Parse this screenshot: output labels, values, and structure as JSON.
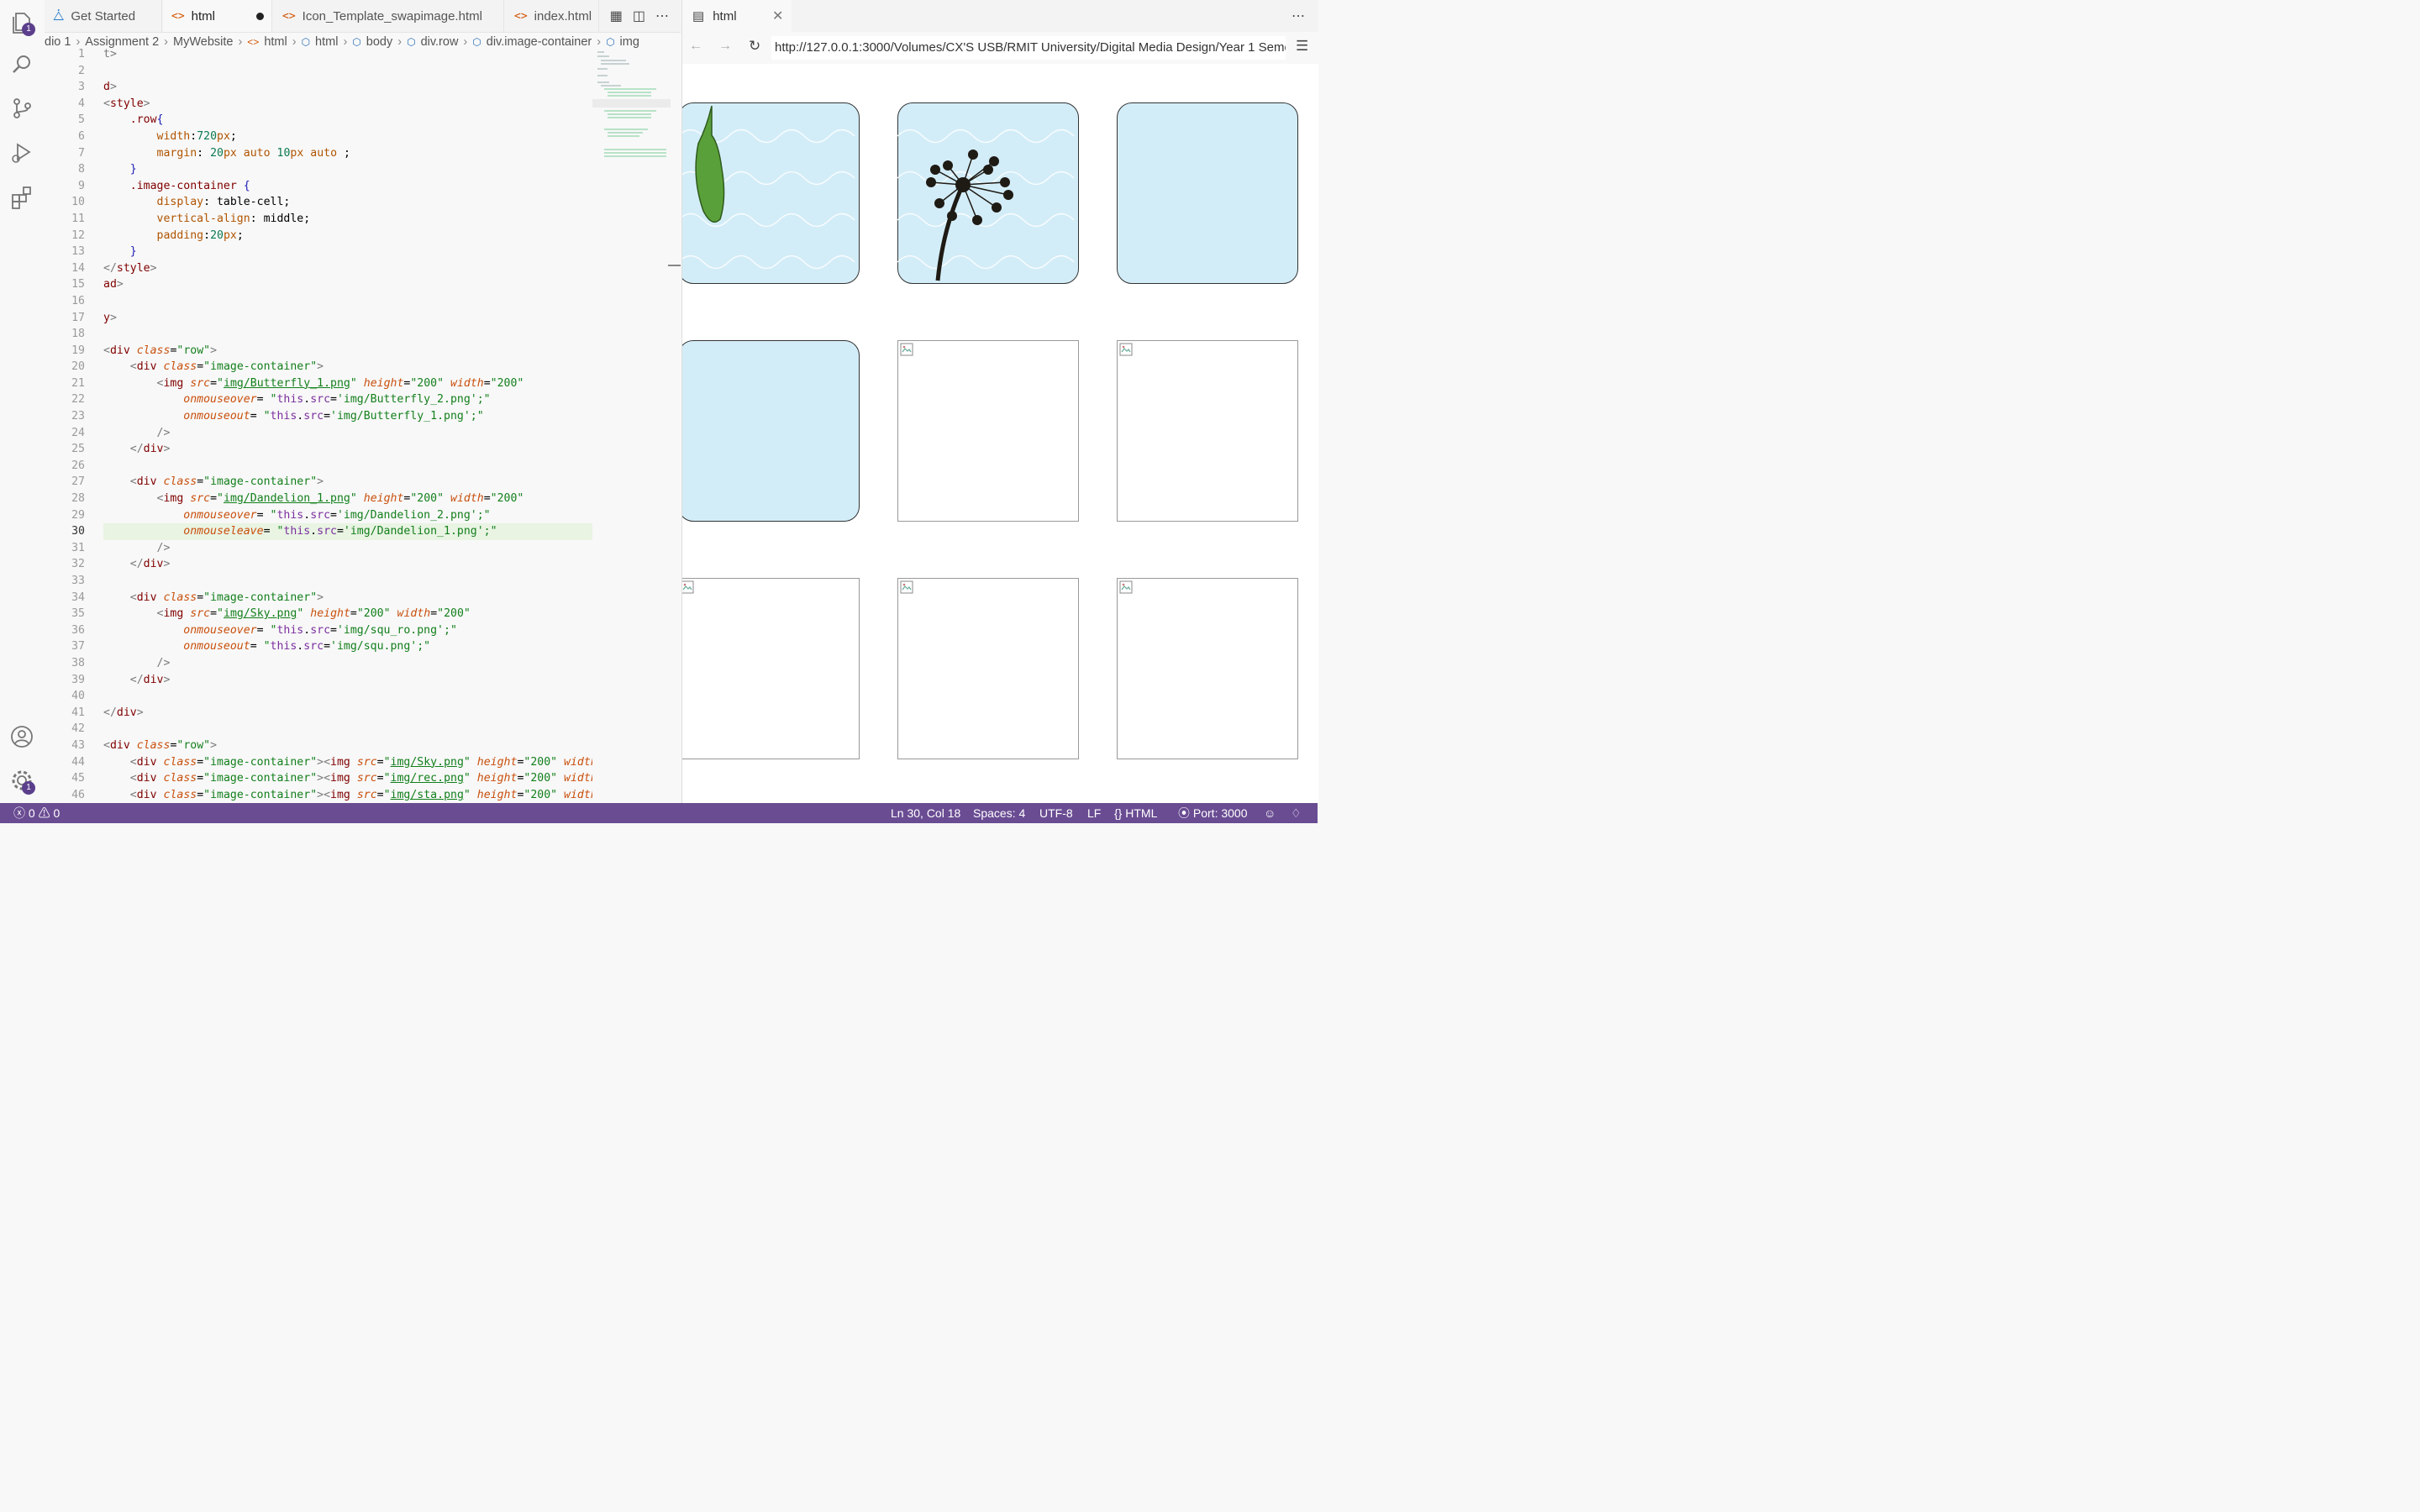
{
  "activity_bar": {
    "explorer_badge": "1",
    "settings_badge": "1"
  },
  "editor": {
    "tabs": [
      {
        "label": "Get Started"
      },
      {
        "label": "html"
      },
      {
        "label": "Icon_Template_swapimage.html"
      },
      {
        "label": "index.html"
      }
    ],
    "breadcrumb": [
      "dio 1",
      "Assignment 2",
      "MyWebsite",
      "html",
      "html",
      "body",
      "div.row",
      "div.image-container",
      "img"
    ],
    "line_numbers": [
      "1",
      "2",
      "3",
      "4",
      "5",
      "6",
      "7",
      "8",
      "9",
      "10",
      "11",
      "12",
      "13",
      "14",
      "15",
      "16",
      "17",
      "18",
      "19",
      "20",
      "21",
      "22",
      "23",
      "24",
      "25",
      "26",
      "27",
      "28",
      "29",
      "30",
      "31",
      "32",
      "33",
      "34",
      "35",
      "36",
      "37",
      "38",
      "39",
      "40",
      "41",
      "42",
      "43",
      "44",
      "45",
      "46"
    ]
  },
  "browser": {
    "tab_label": "html",
    "url": "http://127.0.0.1:3000/Volumes/CX'S USB/RMIT University/Digital Media Design/Year 1 Semester 1"
  },
  "status_bar": {
    "errors": "0",
    "warnings": "0",
    "position": "Ln 30, Col 18",
    "spaces": "Spaces: 4",
    "encoding": "UTF-8",
    "eol": "LF",
    "language": "HTML",
    "port": "Port: 3000"
  },
  "colors": {
    "status_bar": "#6a4c93",
    "tile_fill": "#d3edf8",
    "leaf_green": "#5aa03a"
  }
}
